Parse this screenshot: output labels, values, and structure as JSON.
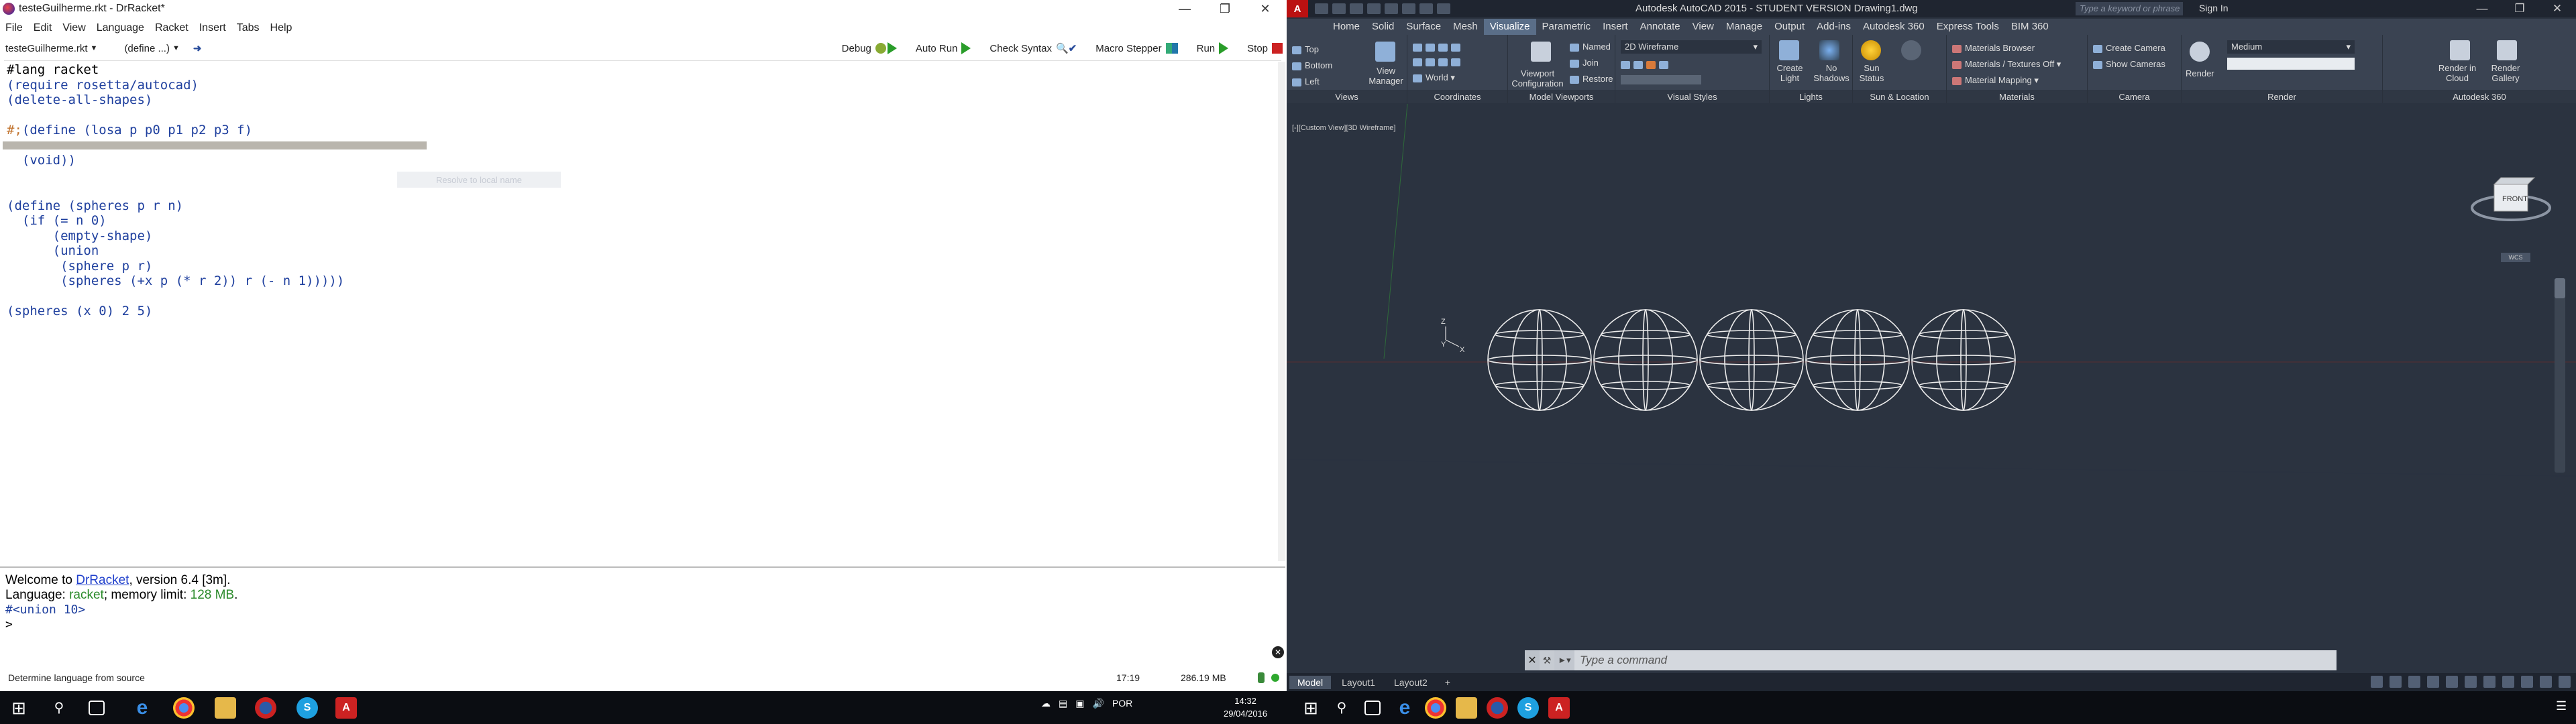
{
  "drracket": {
    "window_title": "testeGuilherme.rkt - DrRacket*",
    "menu": [
      "File",
      "Edit",
      "View",
      "Language",
      "Racket",
      "Insert",
      "Tabs",
      "Help"
    ],
    "file_selector": "testeGuilherme.rkt",
    "define_selector": "(define ...)",
    "toolbar": {
      "debug": "Debug",
      "auto_run": "Auto Run",
      "check_syntax": "Check Syntax",
      "macro_stepper": "Macro Stepper",
      "run": "Run",
      "stop": "Stop"
    },
    "code": {
      "l1": "#lang racket",
      "l2": "(require rosetta/autocad)",
      "l3": "(delete-all-shapes)",
      "l4_prefix": "#;",
      "l4": "(define (losa p p0 p1 p2 p3 f)",
      "l5": "  (void))",
      "l6": "(define (spheres p r n)",
      "l7": "  (if (= n 0)",
      "l8": "      (empty-shape)",
      "l9": "      (union",
      "l10": "       (sphere p r)",
      "l11": "       (spheres (+x p (* r 2)) r (- n 1)))))",
      "l12": "(spheres (x 0) 2 5)"
    },
    "tooltip": "Resolve to local name",
    "repl": {
      "welcome_pre": "Welcome to ",
      "welcome_link": "DrRacket",
      "welcome_post": ", version 6.4 [3m].",
      "lang_pre": "Language: ",
      "lang_name": "racket",
      "lang_post": "; memory limit: ",
      "mem_limit": "128 MB",
      "mem_post": ".",
      "result": "#<union 10>",
      "prompt": ">"
    },
    "status": {
      "language": "Determine language from source",
      "position": "17:19",
      "memory": "286.19 MB"
    }
  },
  "autocad": {
    "title": "Autodesk AutoCAD 2015 - STUDENT VERSION    Drawing1.dwg",
    "search_placeholder": "Type a keyword or phrase",
    "sign_in": "Sign In",
    "tabs": [
      "Home",
      "Solid",
      "Surface",
      "Mesh",
      "Visualize",
      "Parametric",
      "Insert",
      "Annotate",
      "View",
      "Manage",
      "Output",
      "Add-ins",
      "Autodesk 360",
      "Express Tools",
      "BIM 360"
    ],
    "active_tab": "Visualize",
    "panels": {
      "views": "Views",
      "coordinates": "Coordinates",
      "model_viewports": "Model Viewports",
      "visual_styles": "Visual Styles",
      "lights": "Lights",
      "sun_location": "Sun & Location",
      "materials": "Materials",
      "camera": "Camera",
      "render": "Render",
      "a360": "Autodesk 360"
    },
    "views_list": [
      "Top",
      "Bottom",
      "Left"
    ],
    "view_manager": "View Manager",
    "world": "World",
    "named": "Named",
    "join": "Join",
    "restore": "Restore",
    "viewport_config": "Viewport Configuration",
    "visual_style": "2D Wireframe",
    "create_light": "Create Light",
    "no_shadows": "No Shadows",
    "sun_status": "Sun Status",
    "materials_browser": "Materials Browser",
    "materials_textures": "Materials / Textures Off",
    "material_mapping": "Material Mapping",
    "create_camera": "Create Camera",
    "show_cameras": "Show Cameras",
    "render": "Render",
    "render_quality": "Medium",
    "render_in_cloud": "Render in Cloud",
    "render_gallery": "Render Gallery",
    "viewport_label": "[-][Custom View][3D Wireframe]",
    "viewcube_face": "FRONT",
    "wcs": "WCS",
    "command_placeholder": "Type a command",
    "layout_tabs": [
      "Model",
      "Layout1",
      "Layout2"
    ]
  },
  "taskbar": {
    "lang": "POR",
    "time": "14:32",
    "date": "29/04/2016"
  }
}
